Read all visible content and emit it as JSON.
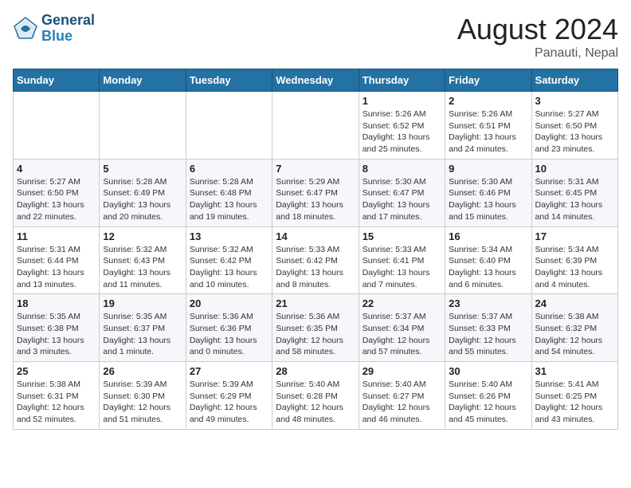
{
  "header": {
    "logo_line1": "General",
    "logo_line2": "Blue",
    "month_year": "August 2024",
    "location": "Panauti, Nepal"
  },
  "weekdays": [
    "Sunday",
    "Monday",
    "Tuesday",
    "Wednesday",
    "Thursday",
    "Friday",
    "Saturday"
  ],
  "weeks": [
    [
      {
        "day": "",
        "info": ""
      },
      {
        "day": "",
        "info": ""
      },
      {
        "day": "",
        "info": ""
      },
      {
        "day": "",
        "info": ""
      },
      {
        "day": "1",
        "info": "Sunrise: 5:26 AM\nSunset: 6:52 PM\nDaylight: 13 hours\nand 25 minutes."
      },
      {
        "day": "2",
        "info": "Sunrise: 5:26 AM\nSunset: 6:51 PM\nDaylight: 13 hours\nand 24 minutes."
      },
      {
        "day": "3",
        "info": "Sunrise: 5:27 AM\nSunset: 6:50 PM\nDaylight: 13 hours\nand 23 minutes."
      }
    ],
    [
      {
        "day": "4",
        "info": "Sunrise: 5:27 AM\nSunset: 6:50 PM\nDaylight: 13 hours\nand 22 minutes."
      },
      {
        "day": "5",
        "info": "Sunrise: 5:28 AM\nSunset: 6:49 PM\nDaylight: 13 hours\nand 20 minutes."
      },
      {
        "day": "6",
        "info": "Sunrise: 5:28 AM\nSunset: 6:48 PM\nDaylight: 13 hours\nand 19 minutes."
      },
      {
        "day": "7",
        "info": "Sunrise: 5:29 AM\nSunset: 6:47 PM\nDaylight: 13 hours\nand 18 minutes."
      },
      {
        "day": "8",
        "info": "Sunrise: 5:30 AM\nSunset: 6:47 PM\nDaylight: 13 hours\nand 17 minutes."
      },
      {
        "day": "9",
        "info": "Sunrise: 5:30 AM\nSunset: 6:46 PM\nDaylight: 13 hours\nand 15 minutes."
      },
      {
        "day": "10",
        "info": "Sunrise: 5:31 AM\nSunset: 6:45 PM\nDaylight: 13 hours\nand 14 minutes."
      }
    ],
    [
      {
        "day": "11",
        "info": "Sunrise: 5:31 AM\nSunset: 6:44 PM\nDaylight: 13 hours\nand 13 minutes."
      },
      {
        "day": "12",
        "info": "Sunrise: 5:32 AM\nSunset: 6:43 PM\nDaylight: 13 hours\nand 11 minutes."
      },
      {
        "day": "13",
        "info": "Sunrise: 5:32 AM\nSunset: 6:42 PM\nDaylight: 13 hours\nand 10 minutes."
      },
      {
        "day": "14",
        "info": "Sunrise: 5:33 AM\nSunset: 6:42 PM\nDaylight: 13 hours\nand 8 minutes."
      },
      {
        "day": "15",
        "info": "Sunrise: 5:33 AM\nSunset: 6:41 PM\nDaylight: 13 hours\nand 7 minutes."
      },
      {
        "day": "16",
        "info": "Sunrise: 5:34 AM\nSunset: 6:40 PM\nDaylight: 13 hours\nand 6 minutes."
      },
      {
        "day": "17",
        "info": "Sunrise: 5:34 AM\nSunset: 6:39 PM\nDaylight: 13 hours\nand 4 minutes."
      }
    ],
    [
      {
        "day": "18",
        "info": "Sunrise: 5:35 AM\nSunset: 6:38 PM\nDaylight: 13 hours\nand 3 minutes."
      },
      {
        "day": "19",
        "info": "Sunrise: 5:35 AM\nSunset: 6:37 PM\nDaylight: 13 hours\nand 1 minute."
      },
      {
        "day": "20",
        "info": "Sunrise: 5:36 AM\nSunset: 6:36 PM\nDaylight: 13 hours\nand 0 minutes."
      },
      {
        "day": "21",
        "info": "Sunrise: 5:36 AM\nSunset: 6:35 PM\nDaylight: 12 hours\nand 58 minutes."
      },
      {
        "day": "22",
        "info": "Sunrise: 5:37 AM\nSunset: 6:34 PM\nDaylight: 12 hours\nand 57 minutes."
      },
      {
        "day": "23",
        "info": "Sunrise: 5:37 AM\nSunset: 6:33 PM\nDaylight: 12 hours\nand 55 minutes."
      },
      {
        "day": "24",
        "info": "Sunrise: 5:38 AM\nSunset: 6:32 PM\nDaylight: 12 hours\nand 54 minutes."
      }
    ],
    [
      {
        "day": "25",
        "info": "Sunrise: 5:38 AM\nSunset: 6:31 PM\nDaylight: 12 hours\nand 52 minutes."
      },
      {
        "day": "26",
        "info": "Sunrise: 5:39 AM\nSunset: 6:30 PM\nDaylight: 12 hours\nand 51 minutes."
      },
      {
        "day": "27",
        "info": "Sunrise: 5:39 AM\nSunset: 6:29 PM\nDaylight: 12 hours\nand 49 minutes."
      },
      {
        "day": "28",
        "info": "Sunrise: 5:40 AM\nSunset: 6:28 PM\nDaylight: 12 hours\nand 48 minutes."
      },
      {
        "day": "29",
        "info": "Sunrise: 5:40 AM\nSunset: 6:27 PM\nDaylight: 12 hours\nand 46 minutes."
      },
      {
        "day": "30",
        "info": "Sunrise: 5:40 AM\nSunset: 6:26 PM\nDaylight: 12 hours\nand 45 minutes."
      },
      {
        "day": "31",
        "info": "Sunrise: 5:41 AM\nSunset: 6:25 PM\nDaylight: 12 hours\nand 43 minutes."
      }
    ]
  ]
}
